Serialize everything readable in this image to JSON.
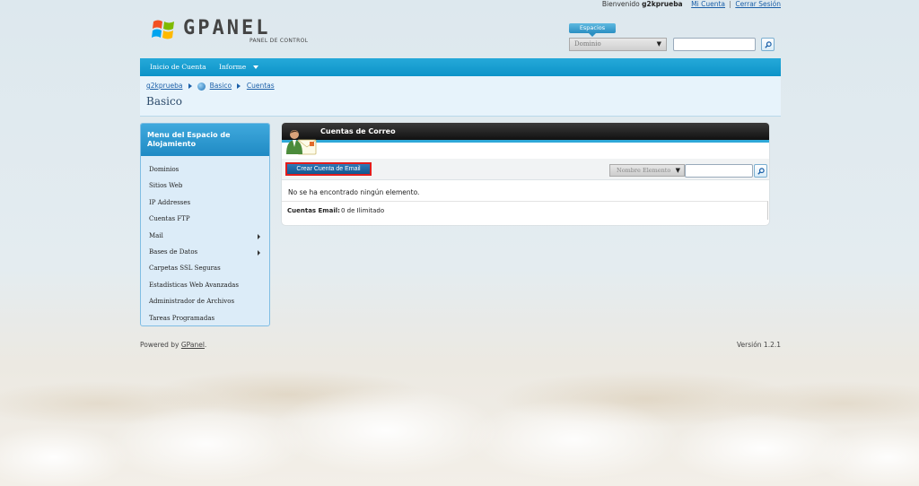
{
  "userbar": {
    "welcome": "Bienvenido",
    "username": "g2kprueba",
    "my_account": "Mi Cuenta",
    "separator": "|",
    "logout": "Cerrar Sesión"
  },
  "logo": {
    "brand": "GPANEL",
    "subtitle": "PANEL DE CONTROL"
  },
  "spaces": {
    "tab_label": "Espacios",
    "domain_select_value": "Dominio",
    "search_value": ""
  },
  "nav": {
    "items": [
      {
        "label": "Inicio de Cuenta"
      },
      {
        "label": "Informe"
      }
    ]
  },
  "breadcrumb": {
    "items": [
      "g2kprueba",
      "Basico",
      "Cuentas"
    ]
  },
  "page_title": "Basico",
  "sidemenu": {
    "title": "Menu del Espacio de Alojamiento",
    "items": [
      {
        "label": "Dominios"
      },
      {
        "label": "Sitios Web"
      },
      {
        "label": "IP Addresses"
      },
      {
        "label": "Cuentas FTP"
      },
      {
        "label": "Mail"
      },
      {
        "label": "Bases de Datos"
      },
      {
        "label": "Carpetas SSL Seguras"
      },
      {
        "label": "Estadísticas Web Avanzadas"
      },
      {
        "label": "Administrador de Archivos"
      },
      {
        "label": "Tareas Programadas"
      }
    ]
  },
  "panel": {
    "title": "Cuentas de Correo",
    "create_button": "Crear Cuenta de Email",
    "sort_select_value": "Nombre Elemento",
    "search_value": "",
    "empty_message": "No se ha encontrado ningún elemento.",
    "quota_label": "Cuentas Email:",
    "quota_value": "0 de Ilimitado"
  },
  "footer": {
    "powered_by": "Powered by",
    "powered_link": "GPanel",
    "powered_end": ".",
    "version": "Versión 1.2.1"
  },
  "colors": {
    "accent": "#1793c9",
    "link": "#1a5fa8",
    "highlight_border": "#e21c1c"
  }
}
